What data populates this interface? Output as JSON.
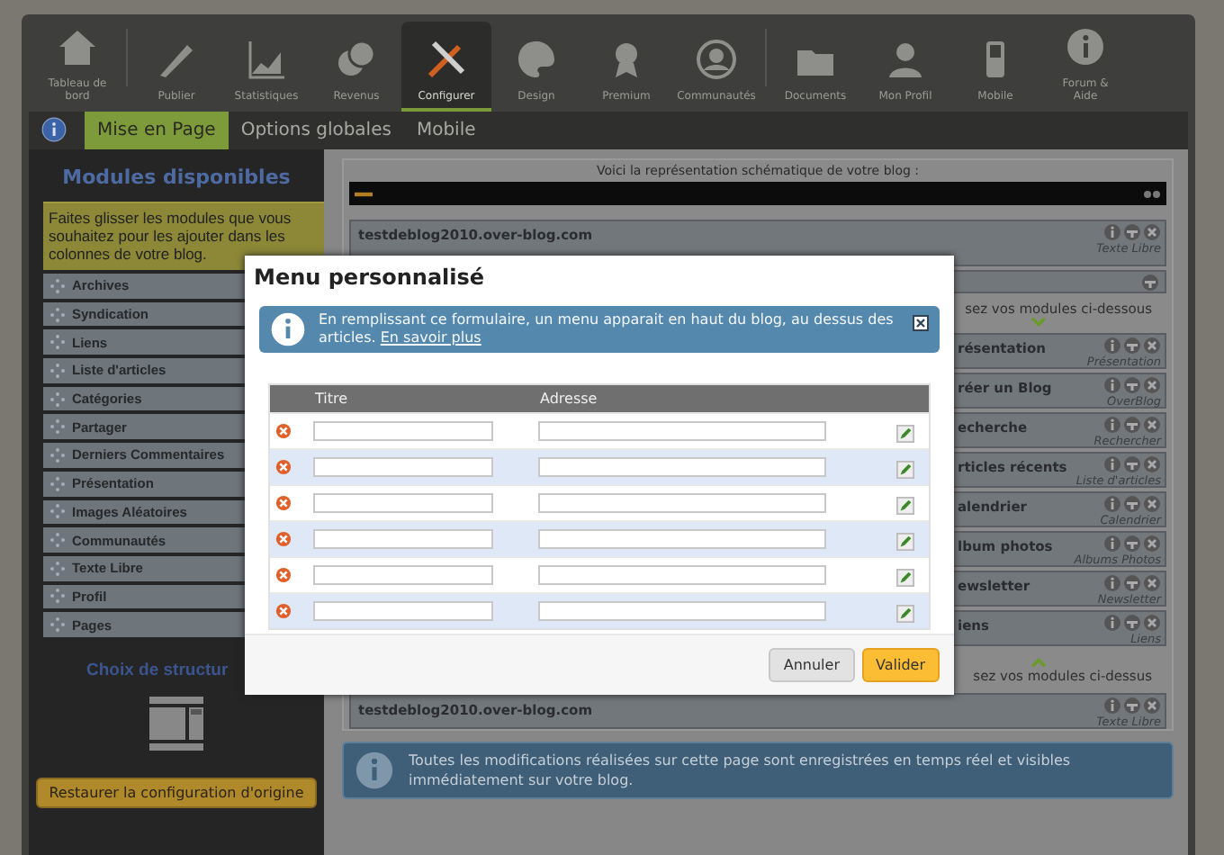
{
  "nav": [
    {
      "label": "Tableau de bord",
      "selected": false
    },
    {
      "label": "Publier",
      "selected": false
    },
    {
      "label": "Statistiques",
      "selected": false
    },
    {
      "label": "Revenus",
      "selected": false
    },
    {
      "label": "Configurer",
      "selected": true
    },
    {
      "label": "Design",
      "selected": false
    },
    {
      "label": "Premium",
      "selected": false
    },
    {
      "label": "Communautés",
      "selected": false
    },
    {
      "label": "Documents",
      "selected": false
    },
    {
      "label": "Mon Profil",
      "selected": false
    },
    {
      "label": "Mobile",
      "selected": false
    },
    {
      "label": "Forum & Aide",
      "selected": false
    }
  ],
  "subtabs": [
    {
      "label": "Mise en Page",
      "selected": true
    },
    {
      "label": "Options globales",
      "selected": false
    },
    {
      "label": "Mobile",
      "selected": false
    }
  ],
  "sidebar": {
    "title": "Modules disponibles",
    "hint": "Faites glisser les modules que vous souhaitez pour les ajouter dans les colonnes de votre blog.",
    "modules": [
      "Archives",
      "Syndication",
      "Liens",
      "Liste d'articles",
      "Catégories",
      "Partager",
      "Derniers Commentaires",
      "Présentation",
      "Images Aléatoires",
      "Communautés",
      "Texte Libre",
      "Profil",
      "Pages"
    ],
    "structure_title": "Choix de structur",
    "restore_button": "Restaurer la configuration d'origine"
  },
  "layout": {
    "intro": "Voici la représentation schématique de votre blog :",
    "rows": [
      {
        "kind": "module",
        "title": "testdeblog2010.over-blog.com",
        "subtitle": "Texte Libre"
      },
      {
        "kind": "bar"
      },
      {
        "kind": "hint_down",
        "text": "sez vos modules ci-dessous"
      },
      {
        "kind": "cut_module",
        "title": "résentation",
        "subtitle": "Présentation"
      },
      {
        "kind": "cut_module",
        "title": "réer un Blog",
        "subtitle": "OverBlog"
      },
      {
        "kind": "cut_module",
        "title": "echerche",
        "subtitle": "Rechercher"
      },
      {
        "kind": "cut_module",
        "title": "rticles récents",
        "subtitle": "Liste d'articles"
      },
      {
        "kind": "cut_module",
        "title": "alendrier",
        "subtitle": "Calendrier"
      },
      {
        "kind": "cut_module",
        "title": "lbum photos",
        "subtitle": "Albums Photos"
      },
      {
        "kind": "cut_module",
        "title": "ewsletter",
        "subtitle": "Newsletter"
      },
      {
        "kind": "cut_module",
        "title": "iens",
        "subtitle": "Liens"
      },
      {
        "kind": "hint_up",
        "text": "sez vos modules ci-dessus"
      },
      {
        "kind": "module",
        "title": "testdeblog2010.over-blog.com",
        "subtitle": "Texte Libre"
      }
    ],
    "notice": "Toutes les modifications réalisées sur cette page sont enregistrées en temps réel et visibles immédiatement sur votre blog."
  },
  "dialog": {
    "title": "Menu personnalisé",
    "info": "En remplissant ce formulaire, un menu apparait en haut du blog, au dessus des articles.",
    "info_link": "En savoir plus",
    "columns": [
      "Titre",
      "Adresse"
    ],
    "rows": [
      {
        "shaded": false
      },
      {
        "shaded": true
      },
      {
        "shaded": false
      },
      {
        "shaded": true
      },
      {
        "shaded": false
      },
      {
        "shaded": true
      }
    ],
    "buttons": [
      {
        "label": "Annuler",
        "kind": "secondary"
      },
      {
        "label": "Valider",
        "kind": "primary"
      }
    ]
  }
}
